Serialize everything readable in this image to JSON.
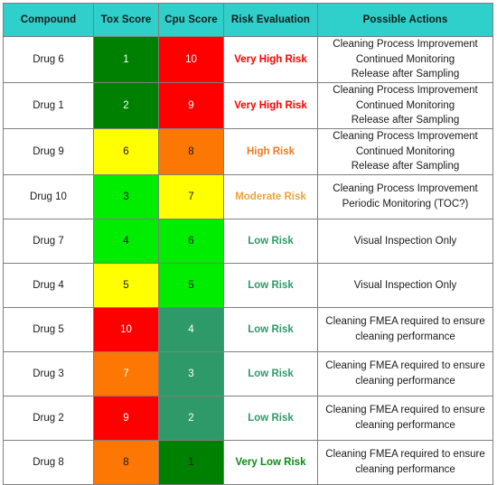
{
  "table": {
    "headers": [
      "Compound",
      "Tox Score",
      "Cpu Score",
      "Risk Evaluation",
      "Possible Actions"
    ],
    "header_bg": "#2FCFCB",
    "risk_colors": {
      "Very High Risk": "#FF0000",
      "High Risk": "#F07B1E",
      "Moderate Risk": "#E8A33D",
      "Low Risk": "#2E9A69",
      "Very Low Risk": "#0A8A16"
    },
    "score_colors": {
      "dark_green": "#008000",
      "sea_green": "#2E9A69",
      "bright_green": "#00ED00",
      "yellow": "#FFFF00",
      "orange": "#FC7703",
      "red": "#FF0000"
    },
    "rows": [
      {
        "compound": "Drug 6",
        "tox": {
          "value": "1",
          "bg": "#008000",
          "fg": "#ffffff"
        },
        "cpu": {
          "value": "10",
          "bg": "#FF0000",
          "fg": "#ffffff"
        },
        "risk": "Very High Risk",
        "risk_color": "#FF0000",
        "actions": [
          "Cleaning Process Improvement",
          "Continued Monitoring",
          "Release after Sampling"
        ]
      },
      {
        "compound": "Drug 1",
        "tox": {
          "value": "2",
          "bg": "#008000",
          "fg": "#ffffff"
        },
        "cpu": {
          "value": "9",
          "bg": "#FF0000",
          "fg": "#ffffff"
        },
        "risk": "Very High Risk",
        "risk_color": "#FF0000",
        "actions": [
          "Cleaning Process Improvement",
          "Continued Monitoring",
          "Release after Sampling"
        ]
      },
      {
        "compound": "Drug 9",
        "tox": {
          "value": "6",
          "bg": "#FFFF00",
          "fg": "#1a1a1a"
        },
        "cpu": {
          "value": "8",
          "bg": "#FC7703",
          "fg": "#1a1a1a"
        },
        "risk": "High Risk",
        "risk_color": "#F07B1E",
        "actions": [
          "Cleaning Process Improvement",
          "Continued Monitoring",
          "Release after Sampling"
        ]
      },
      {
        "compound": "Drug 10",
        "tox": {
          "value": "3",
          "bg": "#00ED00",
          "fg": "#1a1a1a"
        },
        "cpu": {
          "value": "7",
          "bg": "#FFFF00",
          "fg": "#1a1a1a"
        },
        "risk": "Moderate Risk",
        "risk_color": "#E8A33D",
        "actions": [
          "Cleaning Process Improvement",
          "Periodic Monitoring (TOC?)"
        ]
      },
      {
        "compound": "Drug 7",
        "tox": {
          "value": "4",
          "bg": "#00ED00",
          "fg": "#1a1a1a"
        },
        "cpu": {
          "value": "6",
          "bg": "#00ED00",
          "fg": "#1a1a1a"
        },
        "risk": "Low Risk",
        "risk_color": "#2E9A69",
        "actions": [
          "Visual Inspection Only"
        ]
      },
      {
        "compound": "Drug 4",
        "tox": {
          "value": "5",
          "bg": "#FFFF00",
          "fg": "#1a1a1a"
        },
        "cpu": {
          "value": "5",
          "bg": "#00ED00",
          "fg": "#1a1a1a"
        },
        "risk": "Low Risk",
        "risk_color": "#2E9A69",
        "actions": [
          "Visual Inspection Only"
        ]
      },
      {
        "compound": "Drug 5",
        "tox": {
          "value": "10",
          "bg": "#FF0000",
          "fg": "#ffffff"
        },
        "cpu": {
          "value": "4",
          "bg": "#2E9A69",
          "fg": "#ffffff"
        },
        "risk": "Low Risk",
        "risk_color": "#2E9A69",
        "actions": [
          "Cleaning FMEA required to ensure",
          "cleaning performance"
        ]
      },
      {
        "compound": "Drug 3",
        "tox": {
          "value": "7",
          "bg": "#FC7703",
          "fg": "#ffffff"
        },
        "cpu": {
          "value": "3",
          "bg": "#2E9A69",
          "fg": "#ffffff"
        },
        "risk": "Low Risk",
        "risk_color": "#2E9A69",
        "actions": [
          "Cleaning FMEA required to ensure",
          "cleaning performance"
        ]
      },
      {
        "compound": "Drug 2",
        "tox": {
          "value": "9",
          "bg": "#FF0000",
          "fg": "#ffffff"
        },
        "cpu": {
          "value": "2",
          "bg": "#2E9A69",
          "fg": "#ffffff"
        },
        "risk": "Low Risk",
        "risk_color": "#2E9A69",
        "actions": [
          "Cleaning FMEA required to ensure",
          "cleaning performance"
        ]
      },
      {
        "compound": "Drug 8",
        "tox": {
          "value": "8",
          "bg": "#FC7703",
          "fg": "#1a1a1a"
        },
        "cpu": {
          "value": "1",
          "bg": "#008000",
          "fg": "#1a1a1a"
        },
        "risk": "Very Low Risk",
        "risk_color": "#0A8A16",
        "actions": [
          "Cleaning FMEA required to ensure",
          "cleaning performance"
        ]
      }
    ]
  },
  "chart_data": {
    "type": "table",
    "title": "Compound Risk Evaluation Matrix",
    "columns": [
      "Compound",
      "Tox Score",
      "Cpu Score",
      "Risk Evaluation",
      "Possible Actions"
    ],
    "rows": [
      [
        "Drug 6",
        1,
        10,
        "Very High Risk",
        "Cleaning Process Improvement / Continued Monitoring / Release after Sampling"
      ],
      [
        "Drug 1",
        2,
        9,
        "Very High Risk",
        "Cleaning Process Improvement / Continued Monitoring / Release after Sampling"
      ],
      [
        "Drug 9",
        6,
        8,
        "High Risk",
        "Cleaning Process Improvement / Continued Monitoring / Release after Sampling"
      ],
      [
        "Drug 10",
        3,
        7,
        "Moderate Risk",
        "Cleaning Process Improvement / Periodic Monitoring (TOC?)"
      ],
      [
        "Drug 7",
        4,
        6,
        "Low Risk",
        "Visual Inspection Only"
      ],
      [
        "Drug 4",
        5,
        5,
        "Low Risk",
        "Visual Inspection Only"
      ],
      [
        "Drug 5",
        10,
        4,
        "Low Risk",
        "Cleaning FMEA required to ensure cleaning performance"
      ],
      [
        "Drug 3",
        7,
        3,
        "Low Risk",
        "Cleaning FMEA required to ensure cleaning performance"
      ],
      [
        "Drug 2",
        9,
        2,
        "Low Risk",
        "Cleaning FMEA required to ensure cleaning performance"
      ],
      [
        "Drug 8",
        8,
        1,
        "Very Low Risk",
        "Cleaning FMEA required to ensure cleaning performance"
      ]
    ]
  }
}
